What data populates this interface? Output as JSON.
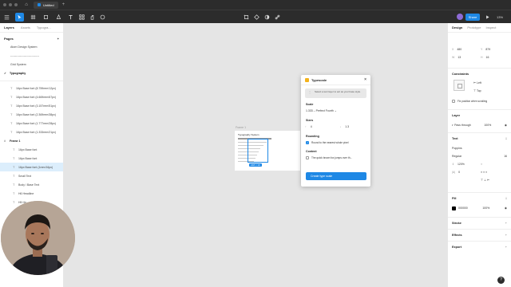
{
  "titlebar": {
    "tab_title": "Untitled",
    "new_tab": "+"
  },
  "toolbar": {
    "share_label": "Share",
    "zoom": "13%"
  },
  "left_panel": {
    "tabs": [
      "Layers",
      "Assets",
      "Typogra..."
    ],
    "pages_header": "Pages",
    "pages": [
      {
        "label": "Atom Design System",
        "current": false
      },
      {
        "label": "------------------------------",
        "current": false
      },
      {
        "label": "Grid System",
        "current": false
      },
      {
        "label": "Typography",
        "current": true
      }
    ],
    "layers_top": [
      "16px Base font (8.759rem/12px)",
      "16px Base font (4.669rem/67px)",
      "16px Base font (3.157rem/51px)",
      "16px Base font (2.369rem/38px)",
      "16px Base font (1.777rem/28px)",
      "16px Base font (1.333rem/21px)"
    ],
    "frame_label": "Frame 1",
    "frame_children": [
      {
        "label": "16px Base font",
        "selected": false
      },
      {
        "label": "16px Base font",
        "selected": false
      },
      {
        "label": "16px Base font (1rem/16px)",
        "selected": true
      },
      {
        "label": "Small Text",
        "selected": false
      },
      {
        "label": "Body / Base Text",
        "selected": false
      },
      {
        "label": "H6 Headline",
        "selected": false
      },
      {
        "label": "H5 He...",
        "selected": false
      }
    ]
  },
  "canvas": {
    "frame_name": "Frame 1",
    "frame_title": "Typography System",
    "size_tag": "218 × 16"
  },
  "plugin": {
    "title": "Typescale",
    "hint": "Select a text layer to act as your base style.",
    "scale_label": "Scale",
    "scale_value": "1.333 – Perfect Fourth",
    "sizes_label": "Sizes",
    "sizes_from": "4",
    "sizes_to": "1.3",
    "rounding_label": "Rounding",
    "rounding_option": "Round to the nearest whole pixel",
    "content_label": "Content",
    "content_option": "The quick brown fox jumps over th...",
    "create_button": "Create type scale"
  },
  "right_panel": {
    "tabs": [
      "Design",
      "Prototype",
      "Inspect"
    ],
    "x": "480",
    "y": "879",
    "w": "13",
    "h": "16",
    "constraints_label": "Constraints",
    "constraint_h": "Left",
    "constraint_v": "Top",
    "fix_position": "Fix position when scrolling",
    "layer_label": "Layer",
    "blend_mode": "Pass through",
    "layer_opacity": "100%",
    "text_label": "Text",
    "font_family": "Poppins",
    "font_weight": "Regular",
    "font_size": "16",
    "line_height": "120%",
    "letter_spacing": "0",
    "fill_label": "Fill",
    "fill_hex": "000000",
    "fill_opacity": "100%",
    "fill_color": "#000000",
    "stroke_label": "Stroke",
    "effects_label": "Effects",
    "export_label": "Export"
  },
  "colors": {
    "accent": "#1e88e5",
    "plugin_logo": "#f3b21c"
  }
}
